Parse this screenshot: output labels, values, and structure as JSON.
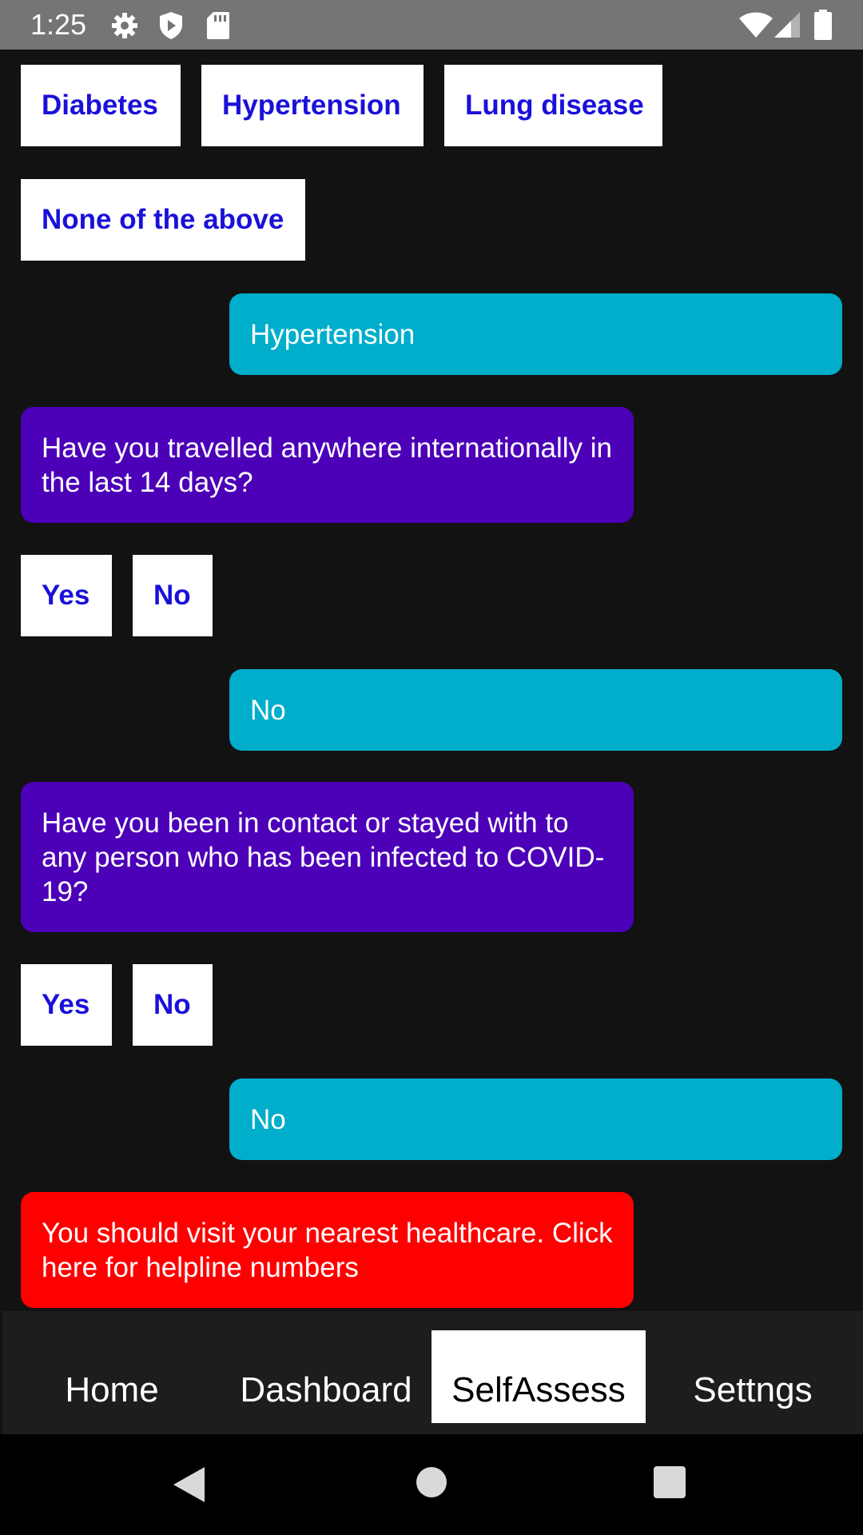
{
  "status_bar": {
    "time": "1:25",
    "icons_left": [
      "gear-icon",
      "shield-icon",
      "sd-card-icon"
    ],
    "icons_right": [
      "wifi-icon",
      "cell-signal-icon",
      "battery-icon"
    ]
  },
  "chat": {
    "conditions_options": [
      "Diabetes",
      "Hypertension",
      "Lung disease",
      "None of the above"
    ],
    "answer_1": "Hypertension",
    "question_travel": "Have you travelled anywhere internationally in the last 14 days?",
    "travel_options": [
      "Yes",
      "No"
    ],
    "answer_2": "No",
    "question_contact": "Have you been in contact or stayed with to any person who has been infected to COVID-19?",
    "contact_options": [
      "Yes",
      "No"
    ],
    "answer_3": "No",
    "result_alert": "You should visit your nearest healthcare. Click here for helpline numbers"
  },
  "bottom_nav": {
    "items": [
      "Home",
      "Dashboard",
      "SelfAssess",
      "Settngs"
    ],
    "active": "SelfAssess"
  },
  "colors": {
    "background": "#121212",
    "user_bubble": "#00aecb",
    "bot_bubble": "#4c00b8",
    "alert_bubble": "#ff0000",
    "option_text": "#1a10d9"
  },
  "system_nav": [
    "back-icon",
    "home-circle-icon",
    "recents-square-icon"
  ]
}
